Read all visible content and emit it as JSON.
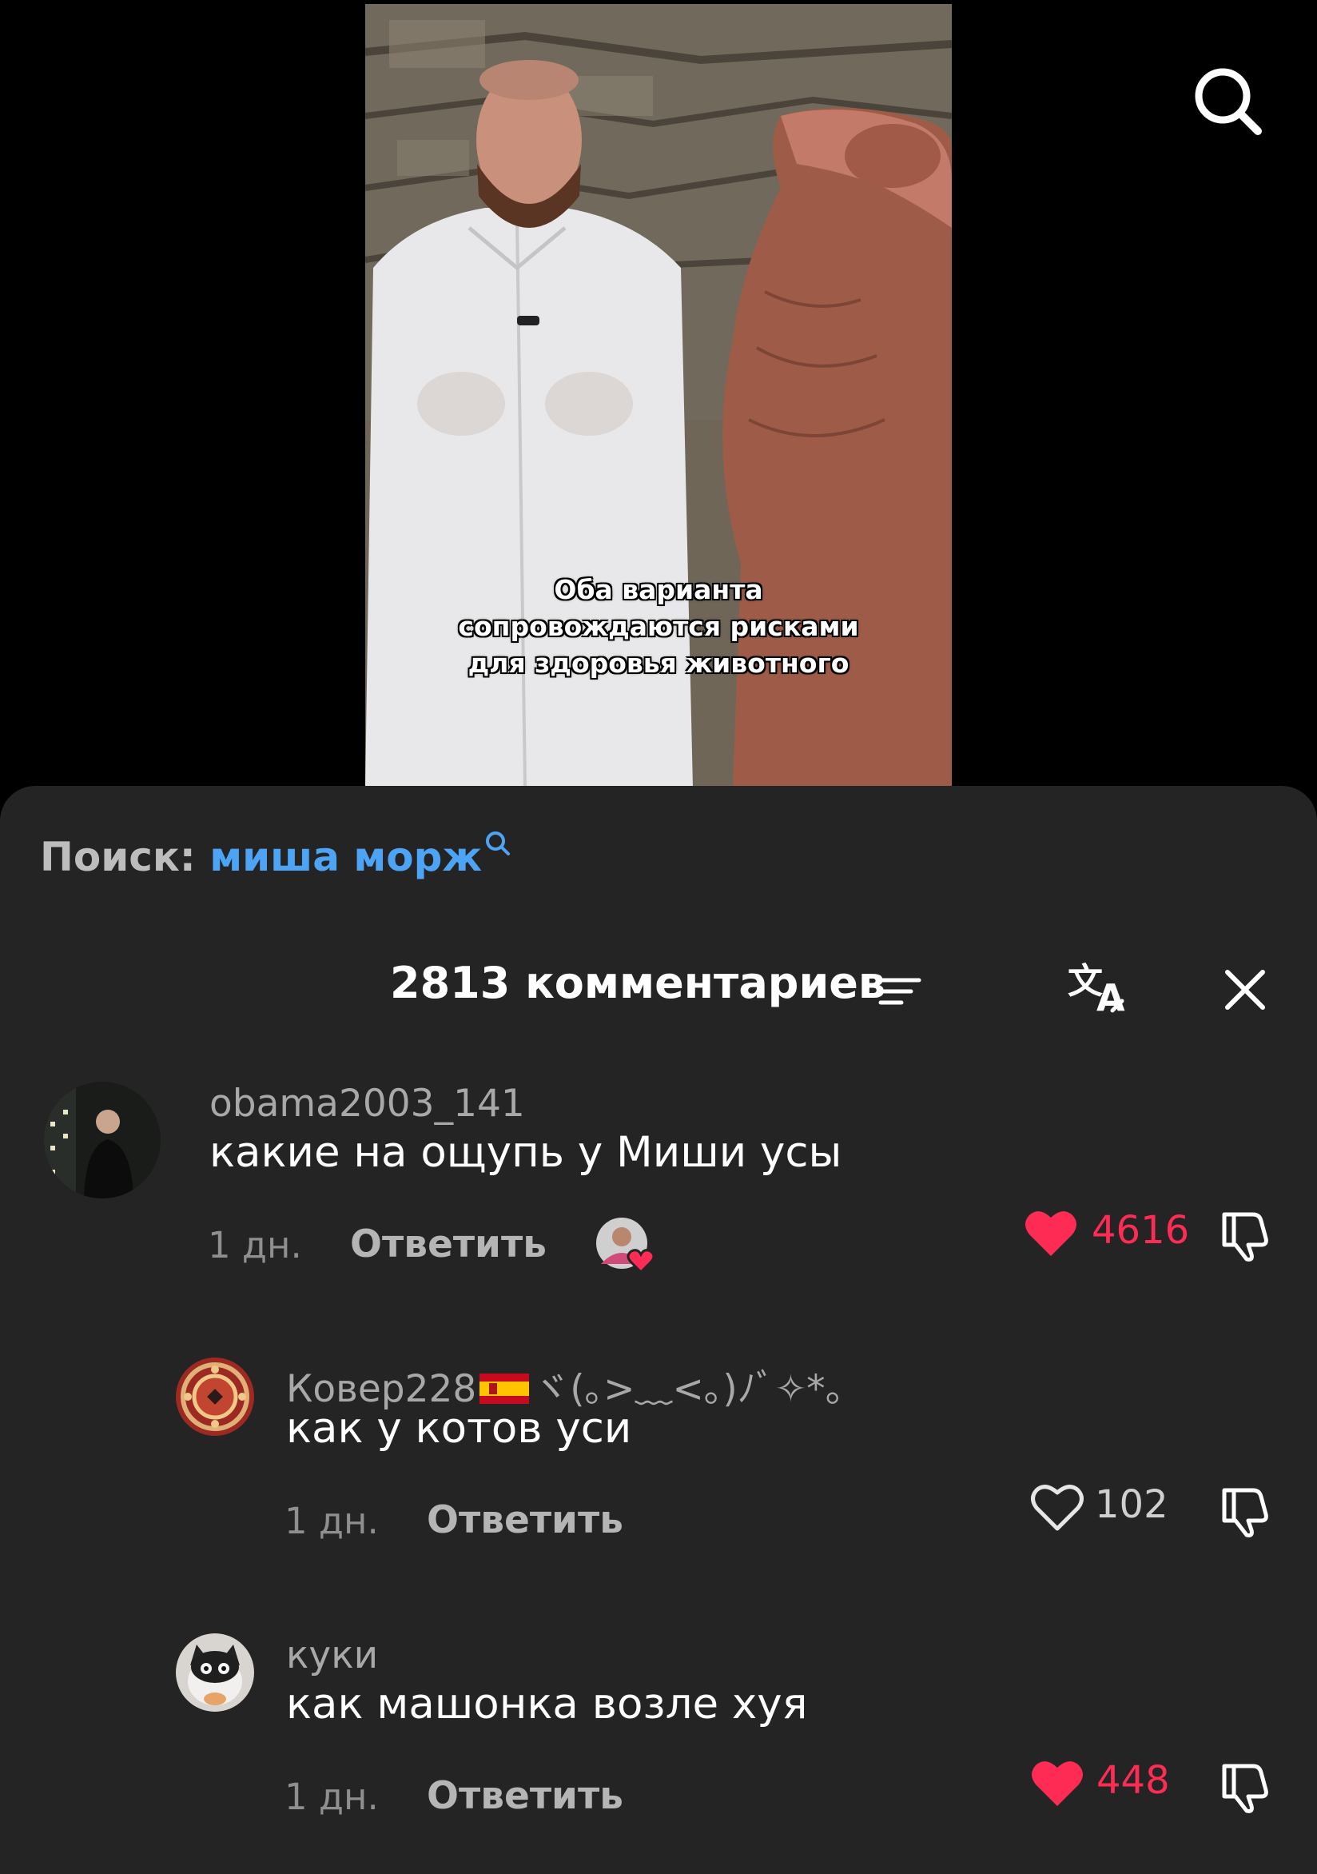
{
  "video": {
    "subtitle_lines": [
      "Оба варианта",
      "сопровождаются рисками",
      "для здоровья животного"
    ]
  },
  "search_suggest": {
    "prefix": "Поиск:",
    "term": "миша морж"
  },
  "header": {
    "count_label": "2813 комментариев"
  },
  "colors": {
    "sheet_bg": "#242424",
    "accent_link": "#4ea4f4",
    "like_active": "#fe2c55"
  },
  "comments": [
    {
      "username": "obama2003_141",
      "text": "какие на ощупь у Миши усы",
      "time": "1 дн.",
      "reply_label": "Ответить",
      "likes": "4616",
      "liked": true,
      "creator_liked": true
    },
    {
      "username": "Ковер228",
      "username_suffix": "ヾ(｡>﹏<｡)ﾉﾞ✧*。",
      "has_flag": "spain-flag",
      "text": "как у котов уси",
      "time": "1 дн.",
      "reply_label": "Ответить",
      "likes": "102",
      "liked": false
    },
    {
      "username": "куки",
      "text": "как машонка возле хуя",
      "time": "1 дн.",
      "reply_label": "Ответить",
      "likes": "448",
      "liked": true
    }
  ],
  "icons": {
    "search": "search-icon",
    "sort": "sort-filter-icon",
    "translate": "translate-icon",
    "close": "close-icon",
    "like": "heart-icon",
    "dislike": "thumbs-down-icon"
  }
}
